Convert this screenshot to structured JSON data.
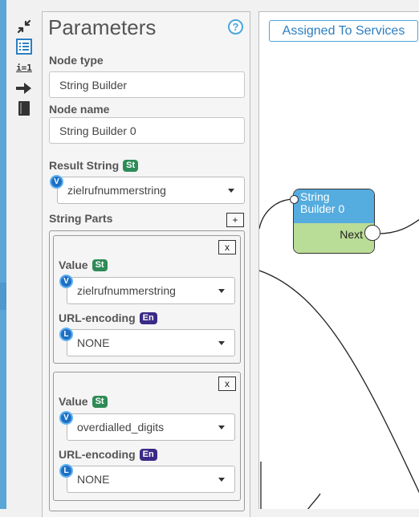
{
  "toolbar": {
    "icons": [
      "collapse-icon",
      "list-icon",
      "assign-icon",
      "arrow-right-icon",
      "book-icon"
    ],
    "assign_label": "i=1"
  },
  "parameters": {
    "title": "Parameters",
    "help": "?",
    "node_type": {
      "label": "Node type",
      "value": "String Builder"
    },
    "node_name": {
      "label": "Node name",
      "value": "String Builder 0"
    },
    "result_string": {
      "label": "Result String",
      "badge": "St",
      "var_icon": "V",
      "value": "zielrufnummerstring"
    },
    "string_parts": {
      "label": "String Parts",
      "add_label": "+",
      "parts": [
        {
          "remove_label": "x",
          "value": {
            "label": "Value",
            "badge": "St",
            "var_icon": "V",
            "selected": "zielrufnummerstring"
          },
          "url_encoding": {
            "label": "URL-encoding",
            "badge": "En",
            "var_icon": "L",
            "selected": "NONE"
          }
        },
        {
          "remove_label": "x",
          "value": {
            "label": "Value",
            "badge": "St",
            "var_icon": "V",
            "selected": "overdialled_digits"
          },
          "url_encoding": {
            "label": "URL-encoding",
            "badge": "En",
            "var_icon": "L",
            "selected": "NONE"
          }
        }
      ]
    }
  },
  "canvas": {
    "assigned_label": "Assigned To Services",
    "node": {
      "title_line1": "String",
      "title_line2": "Builder 0",
      "port_label": "Next"
    }
  },
  "colors": {
    "accent": "#4aa6db",
    "string_badge": "#2e8b57",
    "enum_badge": "#3b2a87",
    "node_header": "#55acdf",
    "node_body": "#b9dc96"
  }
}
